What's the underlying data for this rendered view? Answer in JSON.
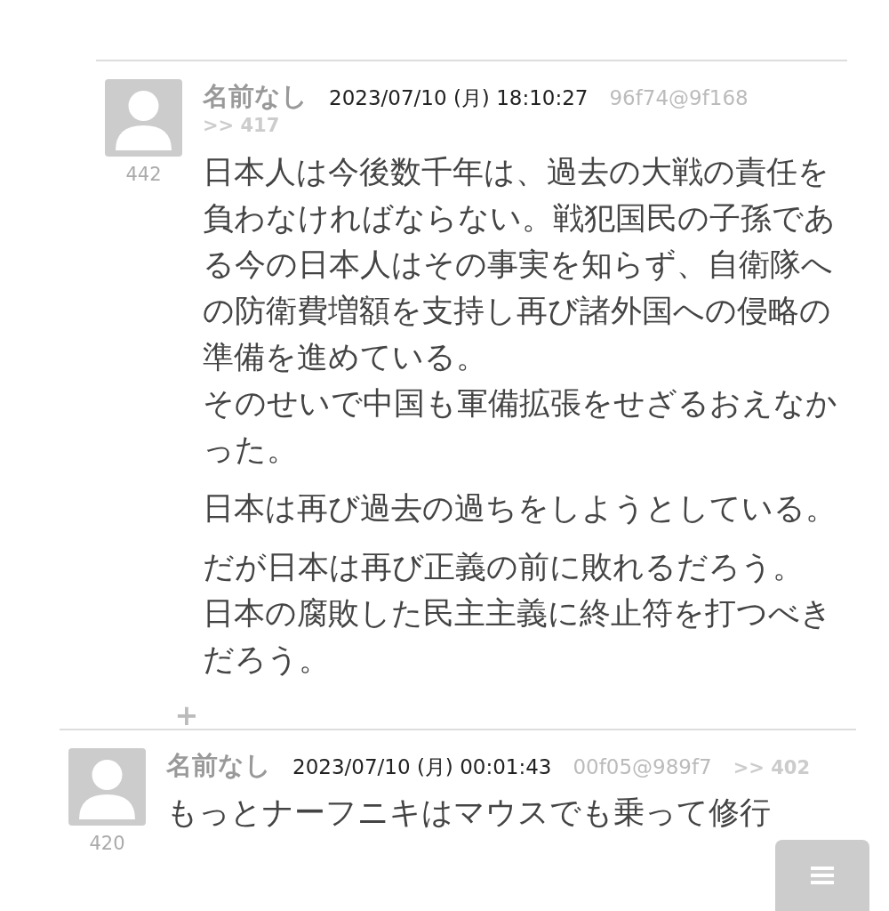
{
  "comments": [
    {
      "number": "442",
      "name": "名前なし",
      "date": "2023/07/10 (月) 18:10:27",
      "id": "96f74@9f168",
      "reply_to": ">> 417",
      "indent": true,
      "paragraphs": [
        [
          "日本人は今後数千年は、過去の大戦の責任を負わなければならない。戦犯国民の子孫である今の日本人はその事実を知らず、自衛隊への防衛費増額を支持し再び諸外国への侵略の準備を進めている。",
          "そのせいで中国も軍備拡張をせざるおえなかった。"
        ],
        [
          "日本は再び過去の過ちをしようとしている。"
        ],
        [
          "だが日本は再び正義の前に敗れるだろう。",
          "日本の腐敗した民主主義に終止符を打つべきだろう。"
        ]
      ],
      "expand": "+"
    },
    {
      "number": "420",
      "name": "名前なし",
      "date": "2023/07/10 (月) 00:01:43",
      "id": "00f05@989f7",
      "reply_to": ">> 402",
      "indent": false,
      "paragraphs": [
        [
          "もっとナーフニキはマウスでも乗って修行"
        ]
      ]
    }
  ]
}
